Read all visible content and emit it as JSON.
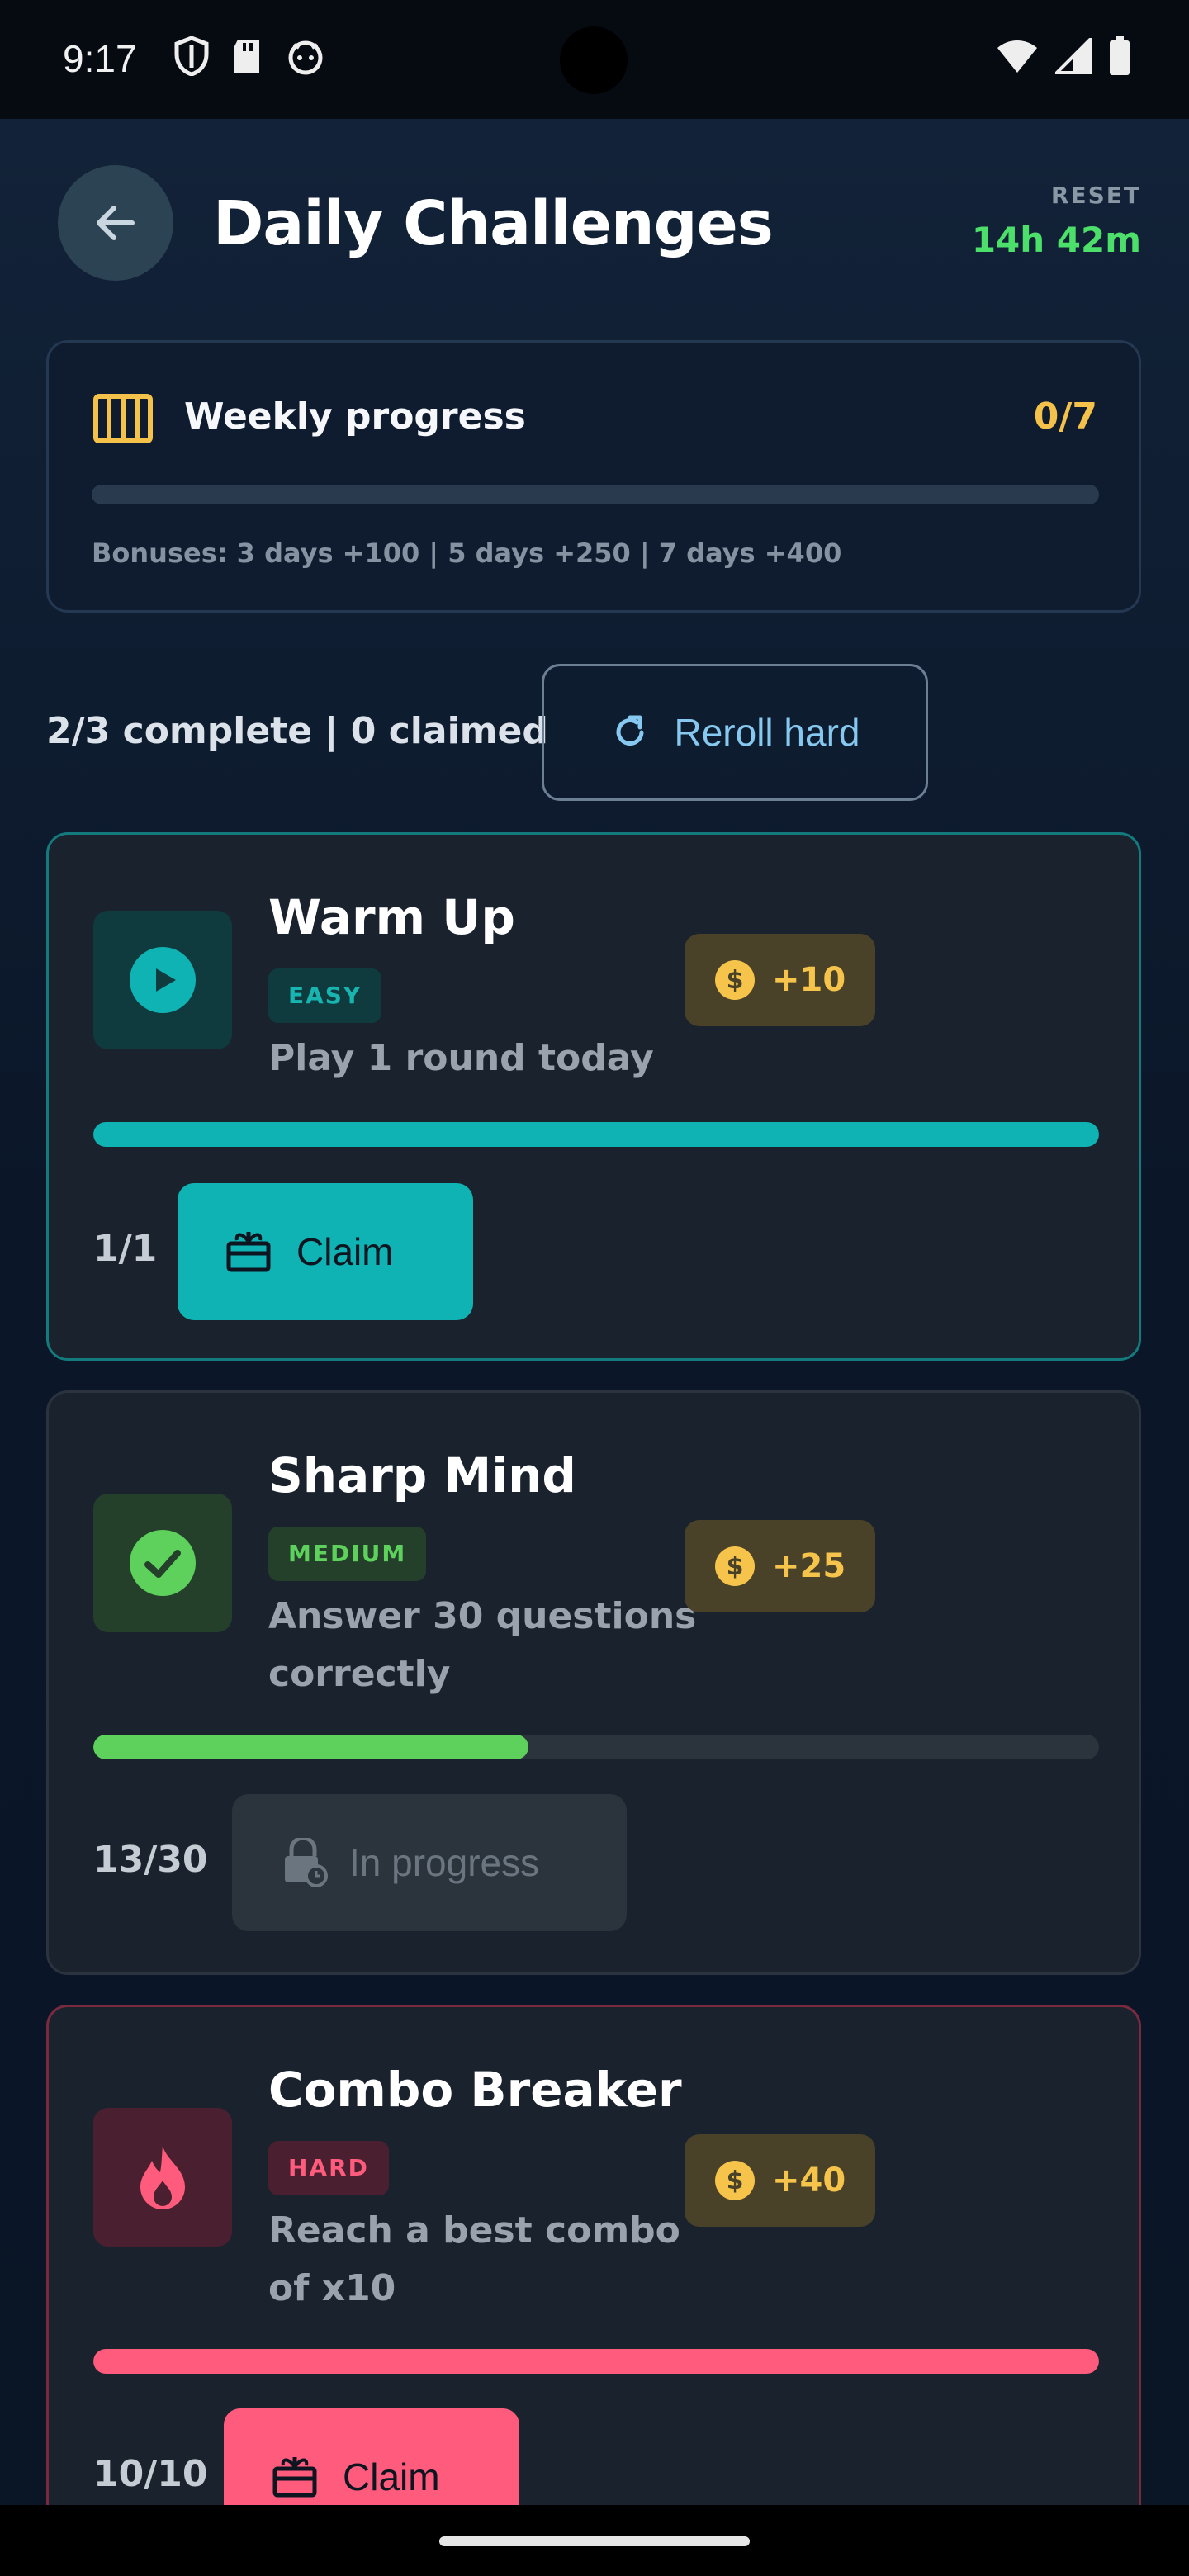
{
  "status_bar": {
    "time": "9:17"
  },
  "header": {
    "title": "Daily Challenges",
    "reset_label": "RESET",
    "reset_time": "14h 42m"
  },
  "weekly": {
    "title": "Weekly progress",
    "count": "0/7",
    "progress": 0,
    "bonuses": "Bonuses: 3 days +100 | 5 days +250 | 7 days +400"
  },
  "summary": {
    "text": "2/3 complete | 0 claimed",
    "reroll_label": "Reroll hard"
  },
  "challenges": [
    {
      "title": "Warm Up",
      "difficulty": "EASY",
      "description": "Play 1 round today",
      "reward": "+10",
      "count": "1/1",
      "progress": 1.0,
      "action": "Claim",
      "accent": "#0fb3b4",
      "icon": "play-icon"
    },
    {
      "title": "Sharp Mind",
      "difficulty": "MEDIUM",
      "description": "Answer 30 questions correctly",
      "reward": "+25",
      "count": "13/30",
      "progress": 0.433,
      "action": "In progress",
      "accent": "#5dd15c",
      "icon": "checkmark-icon"
    },
    {
      "title": "Combo Breaker",
      "difficulty": "HARD",
      "description": "Reach a best combo of x10",
      "reward": "+40",
      "count": "10/10",
      "progress": 1.0,
      "action": "Claim",
      "accent": "#ff5b7d",
      "icon": "flame-icon"
    }
  ]
}
